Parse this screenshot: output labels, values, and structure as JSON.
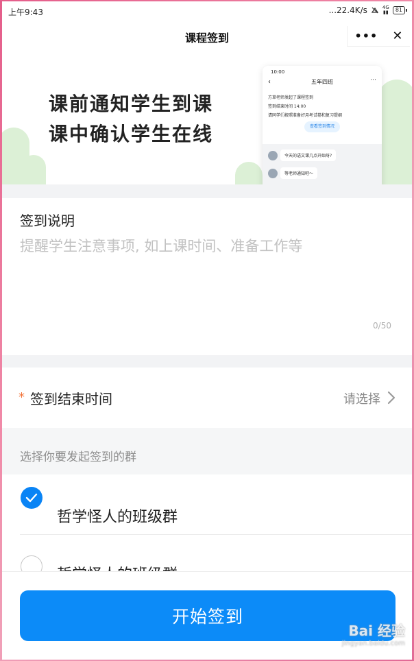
{
  "status_bar": {
    "time": "上午9:43",
    "network": "...22.4K/s",
    "signal": "4G",
    "battery": "81"
  },
  "header": {
    "title": "课程签到",
    "menu_icon": "more-dots-icon",
    "close_icon": "close-icon",
    "menu_glyph": "•••",
    "close_glyph": "✕"
  },
  "banner": {
    "line1": "课前通知学生到课",
    "line2": "课中确认学生在线",
    "mock_phone": {
      "time": "10:00",
      "title": "五年四班",
      "card_title": "方草老师发起了课程签到",
      "card_line1": "签到结束时间 14:00",
      "card_line2": "请同学们按照准备好月考试卷和复习提纲",
      "card_button": "查看签到情况",
      "chat1": "今天的语文课几点开始呀?",
      "chat2": "等老师通知吧～"
    }
  },
  "description": {
    "label": "签到说明",
    "placeholder": "提醒学生注意事项, 如上课时间、准备工作等",
    "value": "",
    "counter": "0/50"
  },
  "end_time": {
    "required_mark": "*",
    "label": "签到结束时间",
    "value": "请选择"
  },
  "groups_hint": "选择你要发起签到的群",
  "groups": [
    {
      "name": "哲学怪人的班级群",
      "checked": true
    },
    {
      "name": "哲学怪人的班级群",
      "checked": false
    }
  ],
  "start_button": "开始签到",
  "watermark": {
    "brand": "Bai 经验",
    "url": "jingyan.baidu.com"
  },
  "colors": {
    "primary": "#0c8bf8",
    "required": "#f2743a",
    "border_frame": "#e45d8a"
  }
}
